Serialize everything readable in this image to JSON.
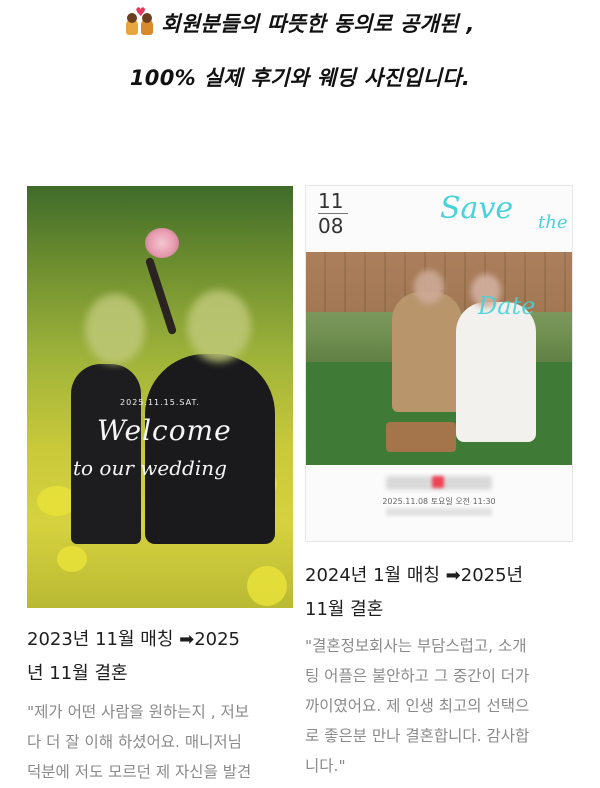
{
  "header": {
    "icon": "couple-kiss-icon",
    "line1": "회원분들의 따뜻한 동의로 공개된 ,",
    "line2": "100% 실제 후기와 웨딩 사진입니다."
  },
  "cards": [
    {
      "photo": {
        "date_text": "2025.11.15.SAT.",
        "overlay_line1": "Welcome",
        "overlay_line2": "to our wedding"
      },
      "title_lines": [
        "2023년 11월 매칭 ➡2025",
        "년 11월 결혼"
      ],
      "quote_lines": [
        "\"제가 어떤 사람을 원하는지 , 저보",
        "다 더 잘 이해 하셨어요. 매니저님",
        "덕분에 저도 모르던 제 자신을 발견"
      ]
    },
    {
      "photo": {
        "month": "11",
        "day": "08",
        "save_text": "Save",
        "the_text": "the",
        "date_text": "Date",
        "info_text": "2025.11.08 토요일 오전 11:30"
      },
      "title_lines": [
        "2024년 1월 매칭 ➡2025년",
        "11월 결혼"
      ],
      "quote_lines": [
        "\"결혼정보회사는 부담스럽고, 소개",
        "팅 어플은 불안하고 그 중간이 더가",
        "까이였어요. 제 인생 최고의 선택으",
        "로 좋은분 만나 결혼합니다. 감사합",
        "니다.\""
      ]
    }
  ],
  "colors": {
    "accent_teal": "#47d3d9",
    "quote_gray": "#8a8a8a"
  }
}
